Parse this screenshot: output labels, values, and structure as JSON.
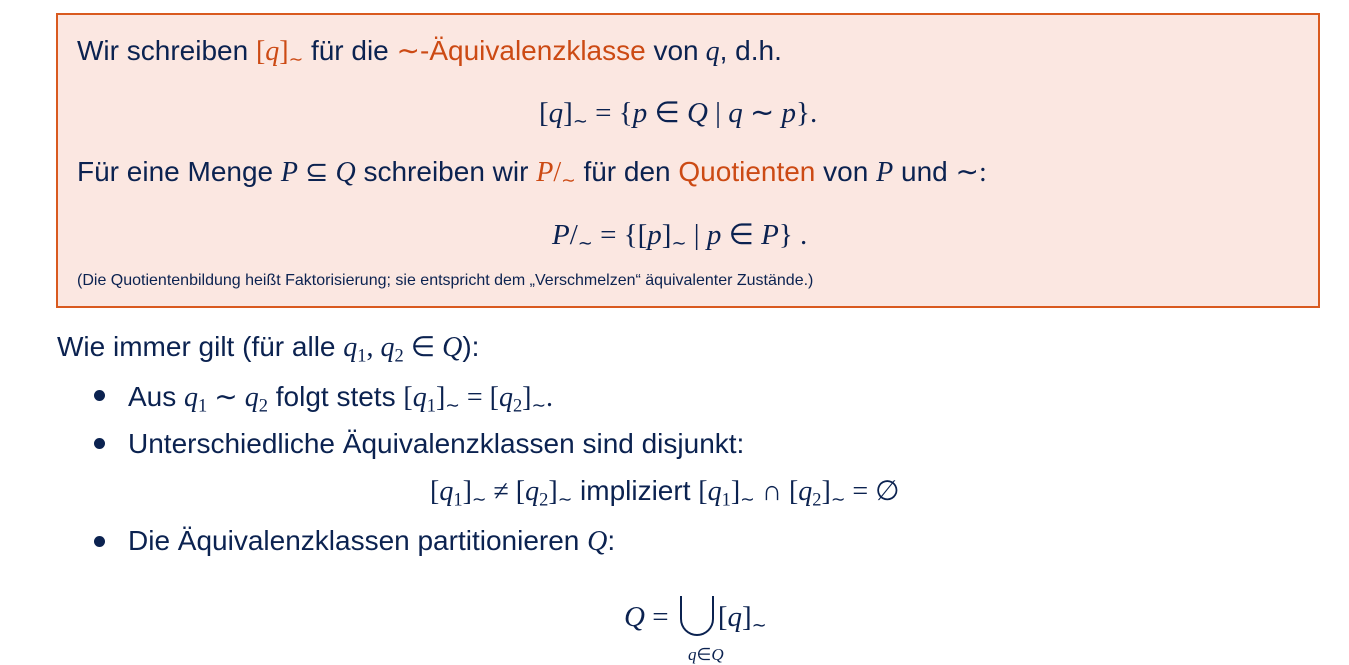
{
  "definition": {
    "l1_a": "Wir schreiben",
    "l1_b": "für die",
    "l1_c": "-Äquivalenzklasse",
    "l1_d": "von",
    "l1_e": ", d.h.",
    "l3_a": "Für eine Menge",
    "l3_b": "schreiben wir",
    "l3_c": "für den",
    "l3_d": "Quotienten",
    "l3_e": "von",
    "l3_f": "und",
    "note": "(Die Quotientenbildung heißt Faktorisierung; sie entspricht dem „Verschmelzen“ äquivalenter Zustände.)"
  },
  "facts": {
    "intro_a": "Wie immer gilt (für alle",
    "intro_b": "):",
    "b1_a": "Aus",
    "b1_b": "folgt stets",
    "b2": "Unterschiedliche Äquivalenzklassen sind disjunkt:",
    "b2_mid": "impliziert",
    "b3": "Die Äquivalenzklassen partitionieren",
    "b3_end": ":"
  },
  "colors": {
    "text": "#0b2250",
    "accent": "#cc4a14",
    "box_bg": "#fbe7e1",
    "box_border": "#d95a1f"
  }
}
